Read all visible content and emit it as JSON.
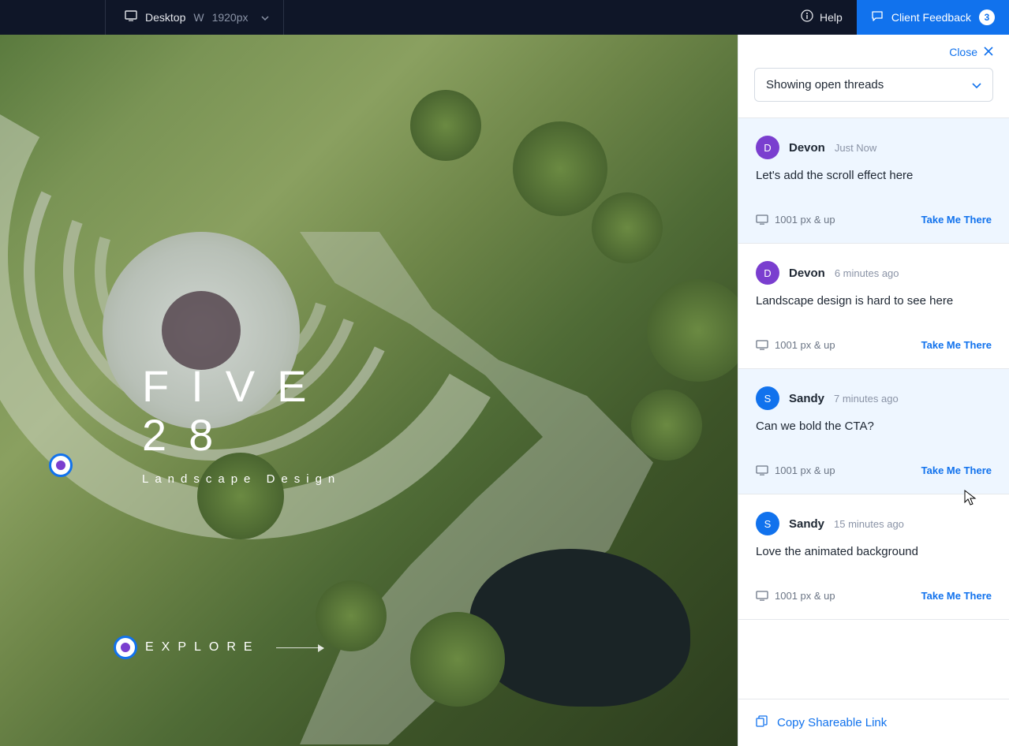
{
  "topbar": {
    "breakpoint_label": "Desktop",
    "width_letter": "W",
    "width_value": "1920px",
    "help_label": "Help",
    "feedback_label": "Client Feedback",
    "feedback_count": "3"
  },
  "hero": {
    "title_line1": "FIVE",
    "title_line2": "28",
    "subtitle": "Landscape Design",
    "explore_label": "EXPLORE"
  },
  "sidebar": {
    "close_label": "Close",
    "filter_value": "Showing open threads",
    "copy_link_label": "Copy Shareable Link",
    "take_label": "Take Me There",
    "threads": [
      {
        "initial": "D",
        "user": "Devon",
        "time": "Just Now",
        "message": "Let's add the scroll effect here",
        "breakpoint": "1001 px & up",
        "avatar_class": "av-purple",
        "selected": true
      },
      {
        "initial": "D",
        "user": "Devon",
        "time": "6 minutes ago",
        "message": "Landscape design is hard to see here",
        "breakpoint": "1001 px & up",
        "avatar_class": "av-purple",
        "selected": false
      },
      {
        "initial": "S",
        "user": "Sandy",
        "time": "7 minutes ago",
        "message": "Can we bold the CTA?",
        "breakpoint": "1001 px & up",
        "avatar_class": "av-blue",
        "selected": true
      },
      {
        "initial": "S",
        "user": "Sandy",
        "time": "15 minutes ago",
        "message": "Love the animated background",
        "breakpoint": "1001 px & up",
        "avatar_class": "av-blue",
        "selected": false
      }
    ]
  }
}
